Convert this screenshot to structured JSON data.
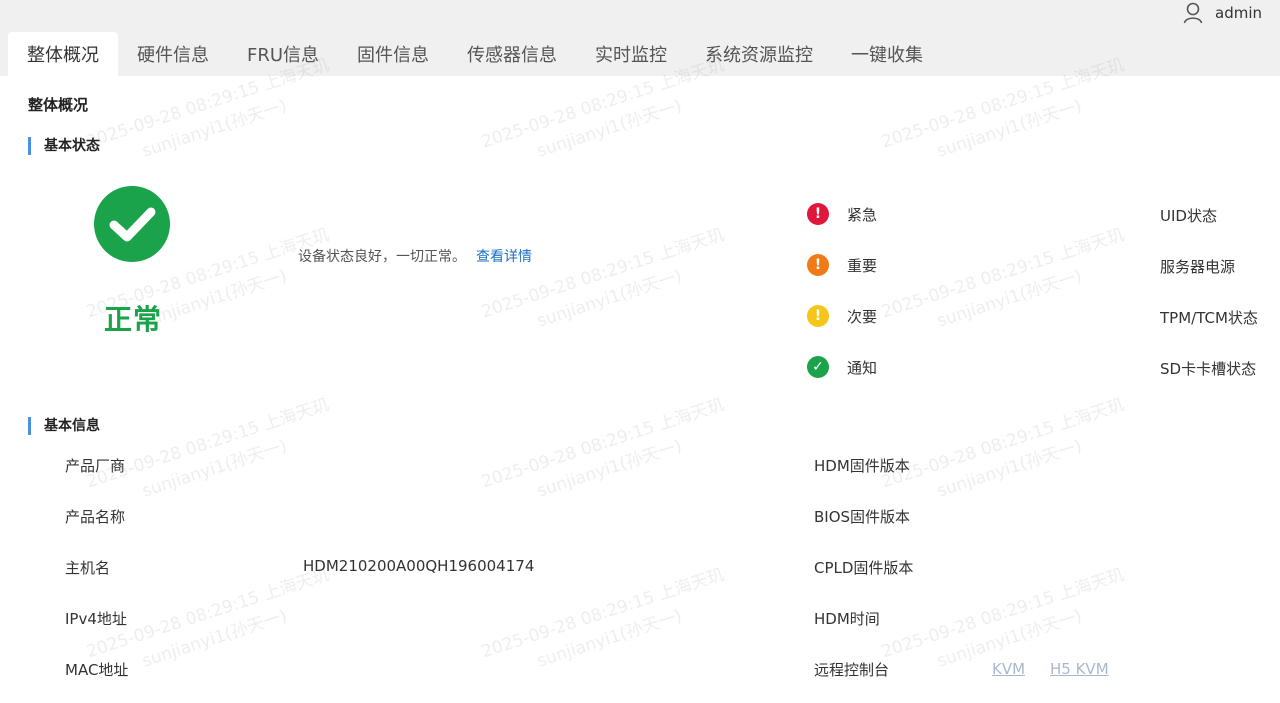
{
  "header": {
    "username": "admin",
    "user_icon": "user-icon"
  },
  "tabs": [
    {
      "label": "整体概况",
      "active": true
    },
    {
      "label": "硬件信息",
      "active": false
    },
    {
      "label": "FRU信息",
      "active": false
    },
    {
      "label": "固件信息",
      "active": false
    },
    {
      "label": "传感器信息",
      "active": false
    },
    {
      "label": "实时监控",
      "active": false
    },
    {
      "label": "系统资源监控",
      "active": false
    },
    {
      "label": "一键收集",
      "active": false
    }
  ],
  "page_title": "整体概况",
  "basic_status": {
    "section_title": "基本状态",
    "status": "正常",
    "status_color": "#1aa34a",
    "description": "设备状态良好，一切正常。",
    "details_link": "查看详情",
    "alerts": [
      {
        "label": "紧急",
        "icon": "critical-icon",
        "symbol": "!",
        "color": "#e0163c"
      },
      {
        "label": "重要",
        "icon": "major-icon",
        "symbol": "!",
        "color": "#f07a16"
      },
      {
        "label": "次要",
        "icon": "minor-icon",
        "symbol": "!",
        "color": "#f5c518"
      },
      {
        "label": "通知",
        "icon": "notice-icon",
        "symbol": "✓",
        "color": "#1aa34a"
      }
    ],
    "side_items": [
      "UID状态",
      "服务器电源",
      "TPM/TCM状态",
      "SD卡卡槽状态"
    ]
  },
  "basic_info": {
    "section_title": "基本信息",
    "left": [
      {
        "label": "产品厂商",
        "value": ""
      },
      {
        "label": "产品名称",
        "value": ""
      },
      {
        "label": "主机名",
        "value": "HDM210200A00QH196004174"
      },
      {
        "label": "IPv4地址",
        "value": ""
      },
      {
        "label": "MAC地址",
        "value": ""
      }
    ],
    "right": [
      {
        "label": "HDM固件版本",
        "value": ""
      },
      {
        "label": "BIOS固件版本",
        "value": ""
      },
      {
        "label": "CPLD固件版本",
        "value": ""
      },
      {
        "label": "HDM时间",
        "value": ""
      },
      {
        "label": "远程控制台",
        "value": ""
      }
    ],
    "console_links": [
      "KVM",
      "H5 KVM"
    ]
  },
  "watermark": {
    "line1": "2025-09-28 08:29:15 上海天玑",
    "line2": "sunjianyi1(孙天一)"
  },
  "colors": {
    "accent": "#4a90e2",
    "link": "#1e6fc0",
    "tab_bar": "#f0f0f0"
  }
}
